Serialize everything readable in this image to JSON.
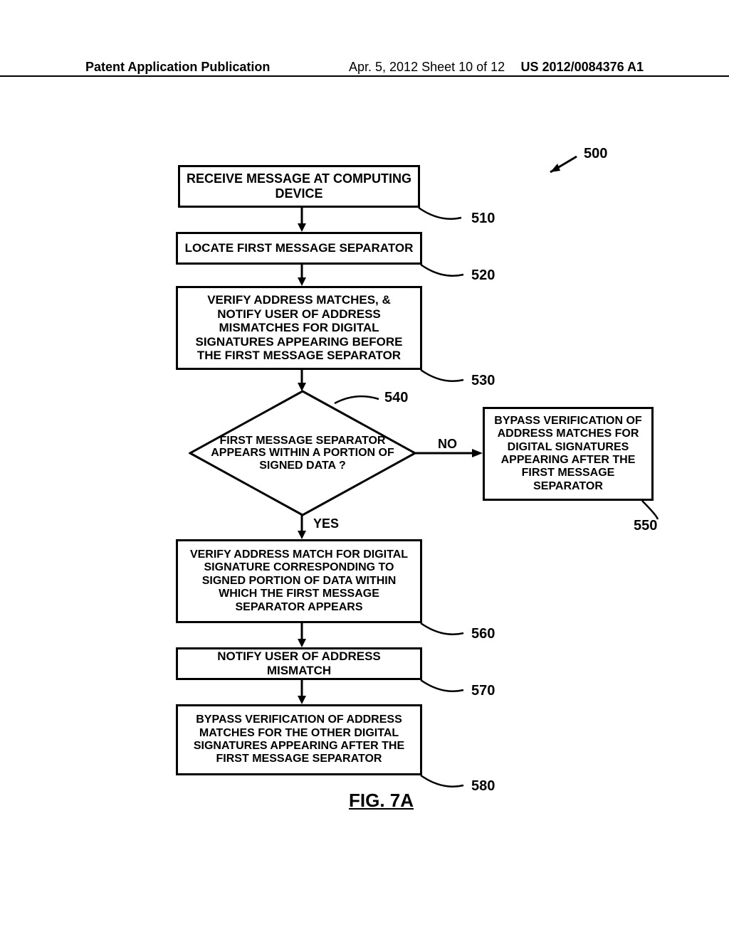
{
  "header": {
    "left": "Patent Application Publication",
    "mid": "Apr. 5, 2012   Sheet 10 of 12",
    "right": "US 2012/0084376 A1"
  },
  "refs": {
    "r500": "500",
    "r510": "510",
    "r520": "520",
    "r530": "530",
    "r540": "540",
    "r550": "550",
    "r560": "560",
    "r570": "570",
    "r580": "580"
  },
  "boxes": {
    "b510": "RECEIVE MESSAGE AT COMPUTING DEVICE",
    "b520": "LOCATE FIRST MESSAGE SEPARATOR",
    "b530": "VERIFY ADDRESS MATCHES, & NOTIFY USER OF ADDRESS MISMATCHES FOR DIGITAL SIGNATURES APPEARING BEFORE THE FIRST MESSAGE SEPARATOR",
    "b550": "BYPASS VERIFICATION OF ADDRESS MATCHES FOR DIGITAL SIGNATURES APPEARING AFTER THE FIRST MESSAGE SEPARATOR",
    "b560": "VERIFY ADDRESS MATCH FOR DIGITAL SIGNATURE CORRESPONDING TO SIGNED PORTION OF DATA WITHIN WHICH THE FIRST MESSAGE SEPARATOR APPEARS",
    "b570": "NOTIFY USER OF ADDRESS MISMATCH",
    "b580": "BYPASS VERIFICATION OF ADDRESS MATCHES FOR THE OTHER DIGITAL SIGNATURES APPEARING AFTER THE FIRST MESSAGE SEPARATOR"
  },
  "diamond": {
    "d540": "FIRST MESSAGE SEPARATOR APPEARS WITHIN A PORTION OF SIGNED DATA ?"
  },
  "labels": {
    "no": "NO",
    "yes": "YES"
  },
  "figure": "FIG. 7A",
  "chart_data": {
    "type": "flowchart",
    "title": "FIG. 7A",
    "figure_ref": "500",
    "nodes": [
      {
        "id": "510",
        "shape": "process",
        "text": "RECEIVE MESSAGE AT COMPUTING DEVICE"
      },
      {
        "id": "520",
        "shape": "process",
        "text": "LOCATE FIRST MESSAGE SEPARATOR"
      },
      {
        "id": "530",
        "shape": "process",
        "text": "VERIFY ADDRESS MATCHES, & NOTIFY USER OF ADDRESS MISMATCHES FOR DIGITAL SIGNATURES APPEARING BEFORE THE FIRST MESSAGE SEPARATOR"
      },
      {
        "id": "540",
        "shape": "decision",
        "text": "FIRST MESSAGE SEPARATOR APPEARS WITHIN A PORTION OF SIGNED DATA ?"
      },
      {
        "id": "550",
        "shape": "process",
        "text": "BYPASS VERIFICATION OF ADDRESS MATCHES FOR DIGITAL SIGNATURES APPEARING AFTER THE FIRST MESSAGE SEPARATOR"
      },
      {
        "id": "560",
        "shape": "process",
        "text": "VERIFY ADDRESS MATCH FOR DIGITAL SIGNATURE CORRESPONDING TO SIGNED PORTION OF DATA WITHIN WHICH THE FIRST MESSAGE SEPARATOR APPEARS"
      },
      {
        "id": "570",
        "shape": "process",
        "text": "NOTIFY USER OF ADDRESS MISMATCH"
      },
      {
        "id": "580",
        "shape": "process",
        "text": "BYPASS VERIFICATION OF ADDRESS MATCHES FOR THE OTHER DIGITAL SIGNATURES APPEARING AFTER THE FIRST MESSAGE SEPARATOR"
      }
    ],
    "edges": [
      {
        "from": "510",
        "to": "520"
      },
      {
        "from": "520",
        "to": "530"
      },
      {
        "from": "530",
        "to": "540"
      },
      {
        "from": "540",
        "to": "550",
        "label": "NO"
      },
      {
        "from": "540",
        "to": "560",
        "label": "YES"
      },
      {
        "from": "560",
        "to": "570"
      },
      {
        "from": "570",
        "to": "580"
      }
    ]
  }
}
